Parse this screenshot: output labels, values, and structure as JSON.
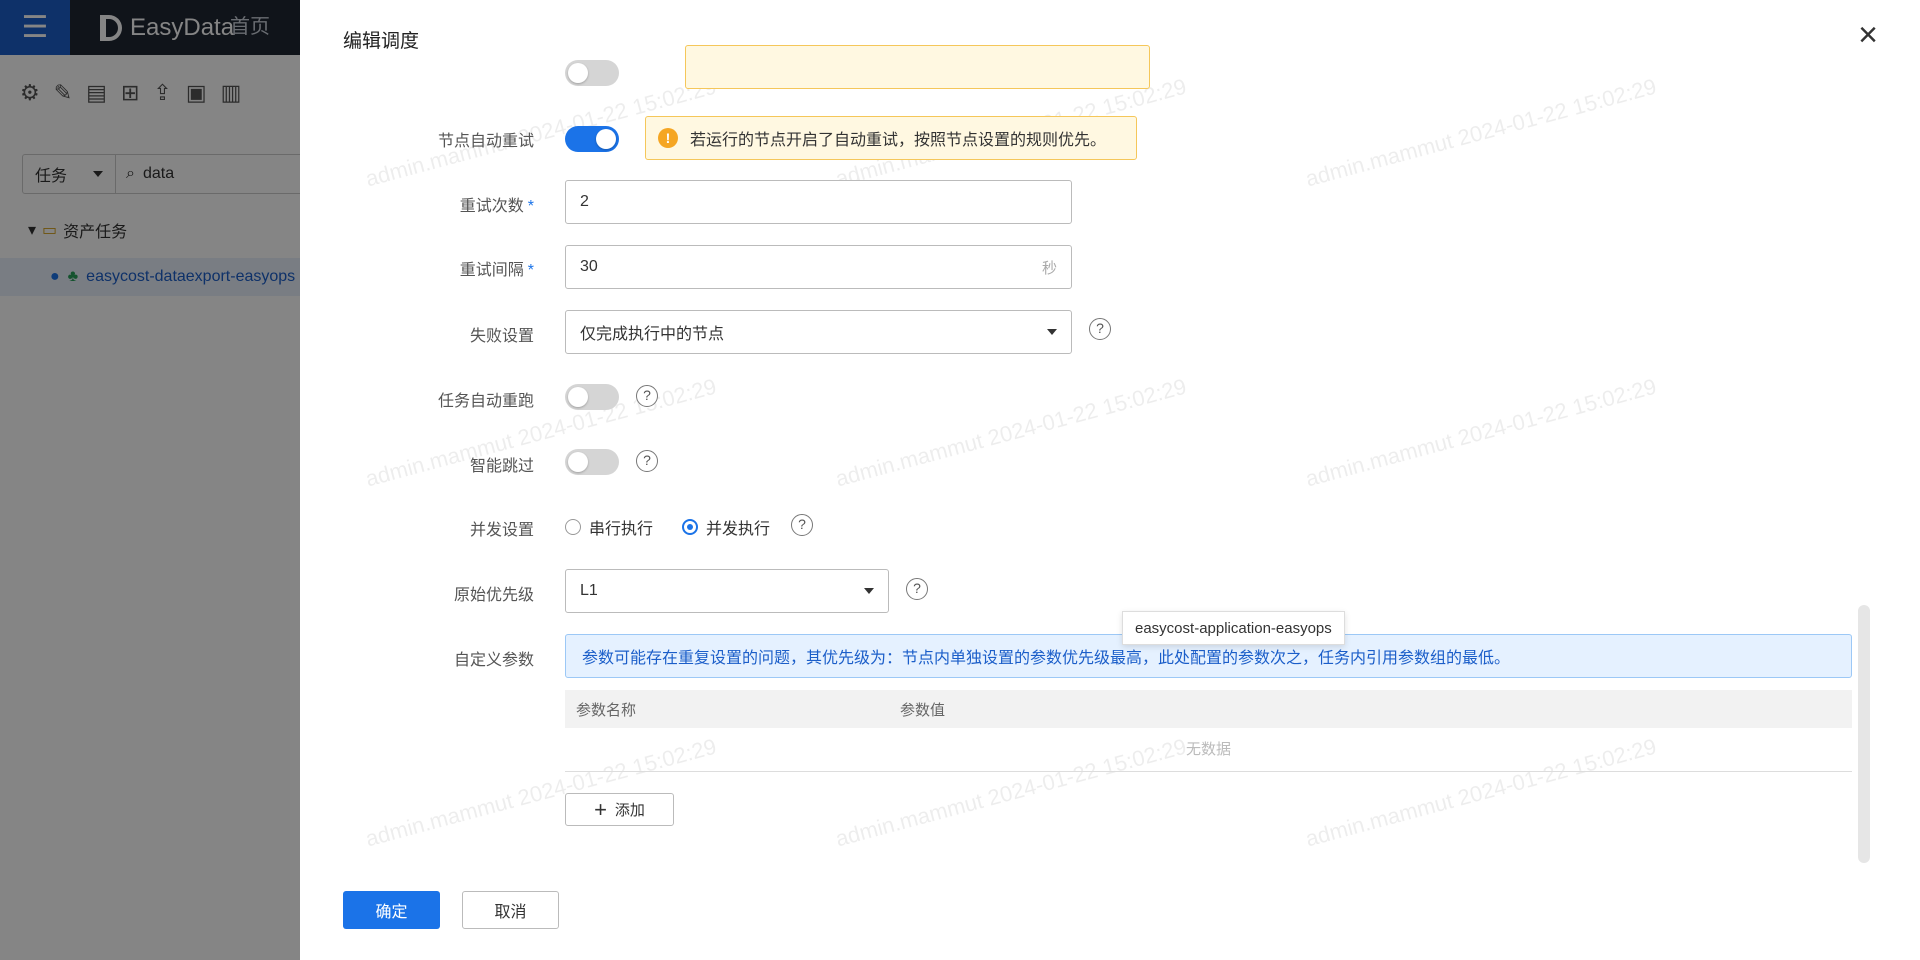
{
  "app": {
    "brand": "EasyData",
    "nav_home": "首页",
    "filter_type": "任务",
    "search_value": "data",
    "tree_root": "资产任务",
    "tree_leaf": "easycost-dataexport-easyops"
  },
  "drawer": {
    "title": "编辑调度",
    "fields": {
      "auto_retry_label": "节点自动重试",
      "auto_retry_on": true,
      "auto_retry_tip": "若运行的节点开启了自动重试，按照节点设置的规则优先。",
      "retry_count_label": "重试次数",
      "retry_count": "2",
      "retry_interval_label": "重试间隔",
      "retry_interval": "30",
      "retry_interval_unit": "秒",
      "failure_label": "失败设置",
      "failure_value": "仅完成执行中的节点",
      "task_rerun_label": "任务自动重跑",
      "task_rerun_on": false,
      "smart_skip_label": "智能跳过",
      "smart_skip_on": false,
      "concurrency_label": "并发设置",
      "concurrency_serial": "串行执行",
      "concurrency_parallel": "并发执行",
      "concurrency_selected": "并发执行",
      "priority_label": "原始优先级",
      "priority_value": "L1",
      "custom_params_label": "自定义参数",
      "custom_params_info": "参数可能存在重复设置的问题，其优先级为：节点内单独设置的参数优先级最高，此处配置的参数次之，任务内引用参数组的最低。",
      "tooltip": "easycost-application-easyops",
      "table_columns": [
        "参数名称",
        "参数值"
      ],
      "table_empty": "无数据",
      "add_button": "添加"
    },
    "confirm_button": "确定",
    "cancel_button": "取消",
    "watermark": "admin.mammut 2024-01-22 15:02:29"
  }
}
